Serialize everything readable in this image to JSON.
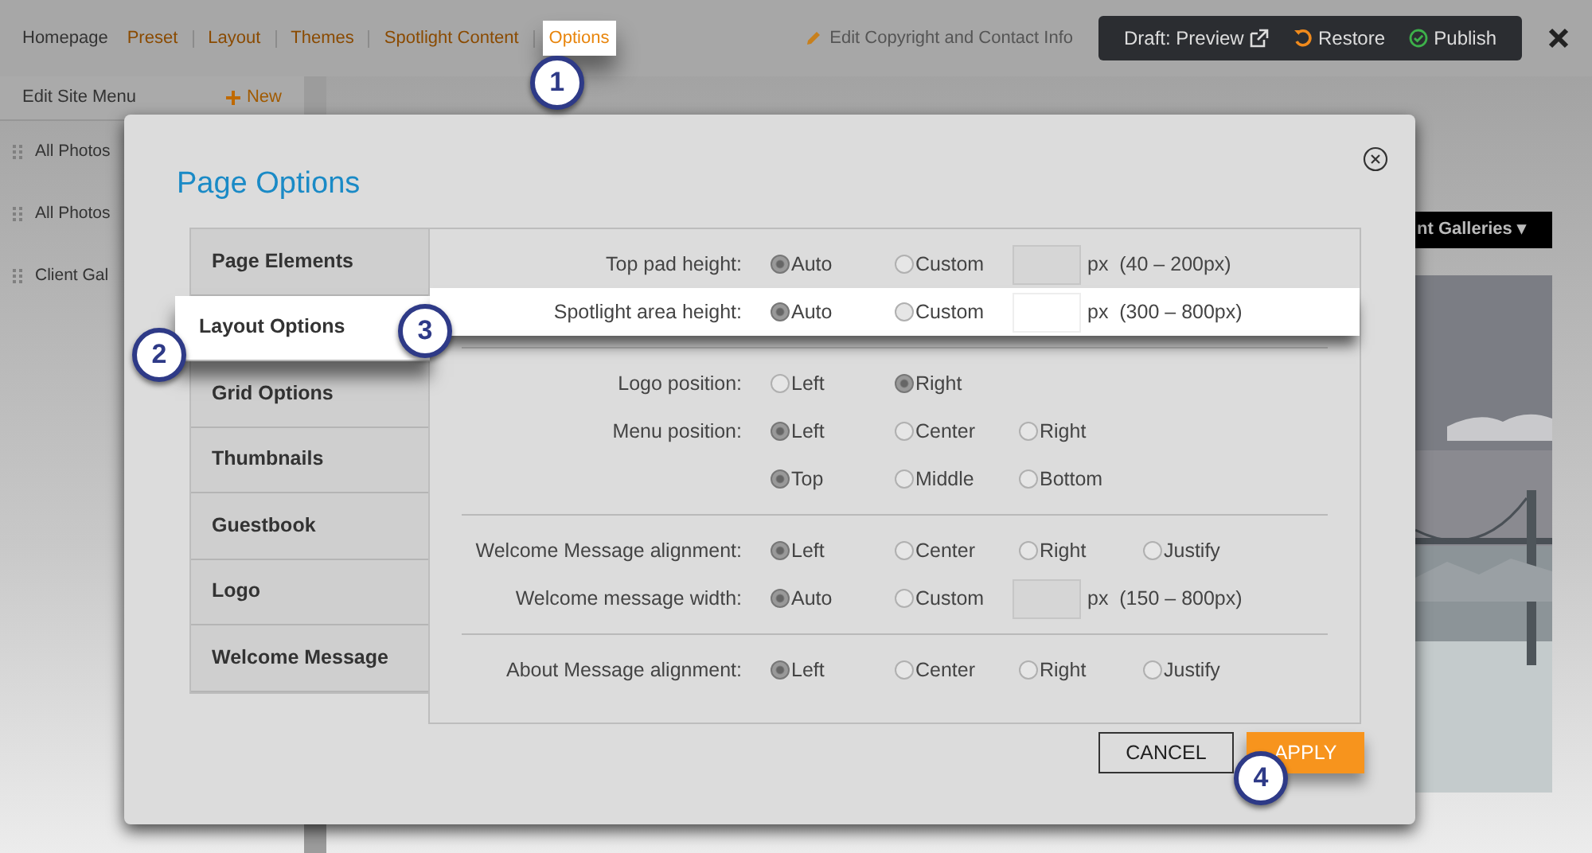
{
  "top_bar": {
    "home_link": "Homepage",
    "nav_links": [
      {
        "label": "Preset",
        "highlighted": false
      },
      {
        "label": "Layout",
        "highlighted": false
      },
      {
        "label": "Themes",
        "highlighted": false
      },
      {
        "label": "Spotlight Content",
        "highlighted": false
      },
      {
        "label": "Options",
        "highlighted": true,
        "callout": "1"
      }
    ],
    "edit_link": "Edit Copyright and Contact Info",
    "actions": [
      {
        "label": "Draft: Preview",
        "kind": "preview"
      },
      {
        "label": "Restore",
        "kind": "restore"
      },
      {
        "label": "Publish",
        "kind": "publish"
      }
    ]
  },
  "site_menu": {
    "title": "Edit Site Menu",
    "new_button": "New",
    "items": [
      "All Photos",
      "All Photos",
      "Client Gal"
    ]
  },
  "site_preview": {
    "menu_item": "nt Galleries ▾"
  },
  "modal": {
    "title": "Page Options",
    "tabs": [
      {
        "label": "Page Elements",
        "selected": false
      },
      {
        "label": "Layout Options",
        "selected": true,
        "callout": "2"
      },
      {
        "label": "Grid Options",
        "selected": false
      },
      {
        "label": "Thumbnails",
        "selected": false
      },
      {
        "label": "Guestbook",
        "selected": false
      },
      {
        "label": "Logo",
        "selected": false
      },
      {
        "label": "Welcome Message",
        "selected": false
      }
    ],
    "sections": [
      {
        "rows": [
          {
            "label": "Top pad height:",
            "highlighted": false,
            "options": [
              {
                "label": "Auto",
                "selected": true
              },
              {
                "label": "Custom",
                "selected": false
              }
            ],
            "custom_field": {
              "unit": "px  (40 – 200px)"
            }
          },
          {
            "label": "Spotlight area height:",
            "highlighted": true,
            "callout": "3",
            "options": [
              {
                "label": "Auto",
                "selected": true
              },
              {
                "label": "Custom",
                "selected": false
              }
            ],
            "custom_field": {
              "unit": "px  (300 – 800px)"
            }
          }
        ]
      },
      {
        "rows": [
          {
            "label": "Logo position:",
            "highlighted": false,
            "options": [
              {
                "label": "Left",
                "selected": false
              },
              {
                "label": "Right",
                "selected": true
              }
            ]
          },
          {
            "label": "Menu position:",
            "highlighted": false,
            "options": [
              {
                "label": "Left",
                "selected": true
              },
              {
                "label": "Center",
                "selected": false
              },
              {
                "label": "Right",
                "selected": false
              }
            ]
          },
          {
            "highlighted": false,
            "options": [
              {
                "label": "Top",
                "selected": true
              },
              {
                "label": "Middle",
                "selected": false
              },
              {
                "label": "Bottom",
                "selected": false
              }
            ]
          }
        ]
      },
      {
        "rows": [
          {
            "label": "Welcome Message alignment:",
            "highlighted": false,
            "options": [
              {
                "label": "Left",
                "selected": true
              },
              {
                "label": "Center",
                "selected": false
              },
              {
                "label": "Right",
                "selected": false
              },
              {
                "label": "Justify",
                "selected": false
              }
            ]
          },
          {
            "label": "Welcome message width:",
            "highlighted": false,
            "options": [
              {
                "label": "Auto",
                "selected": true
              },
              {
                "label": "Custom",
                "selected": false
              }
            ],
            "custom_field": {
              "unit": "px  (150 – 800px)"
            }
          }
        ]
      },
      {
        "rows": [
          {
            "label": "About Message alignment:",
            "highlighted": false,
            "options": [
              {
                "label": "Left",
                "selected": true
              },
              {
                "label": "Center",
                "selected": false
              },
              {
                "label": "Right",
                "selected": false
              },
              {
                "label": "Justify",
                "selected": false
              }
            ]
          }
        ]
      }
    ],
    "buttons": [
      {
        "label": "CANCEL",
        "kind": "secondary"
      },
      {
        "label": "APPLY",
        "kind": "primary",
        "callout": "4"
      }
    ]
  }
}
